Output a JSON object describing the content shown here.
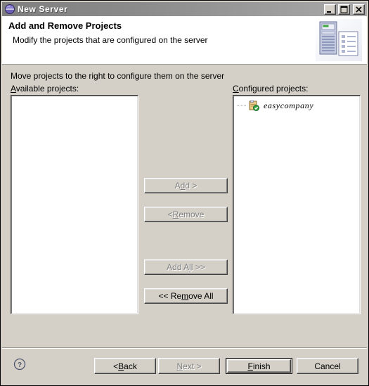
{
  "window": {
    "title": "New Server",
    "title_icon": "server-globe-icon",
    "controls": [
      {
        "name": "minimize-button",
        "glyph": "minimize"
      },
      {
        "name": "maximize-button",
        "glyph": "maximize"
      },
      {
        "name": "close-button",
        "glyph": "close"
      }
    ]
  },
  "banner": {
    "title": "Add and Remove Projects",
    "description": "Modify the projects that are configured on the server",
    "icon": "server-tower-with-document-icon"
  },
  "main": {
    "hint": "Move projects to the right to configure them on the server",
    "available": {
      "label_pre": "A",
      "label_post": "vailable projects:",
      "items": []
    },
    "configured": {
      "label_pre": "C",
      "label_post": "onfigured projects:",
      "items": [
        {
          "label": "easycompany",
          "icon": "project-folder-icon"
        }
      ]
    },
    "transfer_buttons": [
      {
        "name": "add-button",
        "pre": "A",
        "mn": "d",
        "post": "d >",
        "enabled": false
      },
      {
        "name": "remove-button",
        "pre": "< ",
        "mn": "R",
        "post": "emove",
        "enabled": false
      },
      {
        "name": "add-all-button",
        "pre": "Add A",
        "mn": "l",
        "post": "l >>",
        "enabled": false
      },
      {
        "name": "remove-all-button",
        "pre": "<< Re",
        "mn": "m",
        "post": "ove All",
        "enabled": true
      }
    ]
  },
  "footer": {
    "help_icon": "help-question-icon",
    "buttons": [
      {
        "name": "back-button",
        "pre": "< ",
        "mn": "B",
        "post": "ack",
        "enabled": true,
        "default": false
      },
      {
        "name": "next-button",
        "pre": "",
        "mn": "N",
        "post": "ext >",
        "enabled": false,
        "default": false
      },
      {
        "name": "finish-button",
        "pre": "",
        "mn": "F",
        "post": "inish",
        "enabled": true,
        "default": true
      },
      {
        "name": "cancel-button",
        "pre": "Cancel",
        "mn": "",
        "post": "",
        "enabled": true,
        "default": false
      }
    ]
  },
  "colors": {
    "dialog_face": "#d4d0c8",
    "titlebar_left": "#7f7f7f",
    "titlebar_right": "#a9a9a9",
    "banner_bg": "#ffffff",
    "list_bg": "#ffffff",
    "disabled_text": "#808080"
  }
}
